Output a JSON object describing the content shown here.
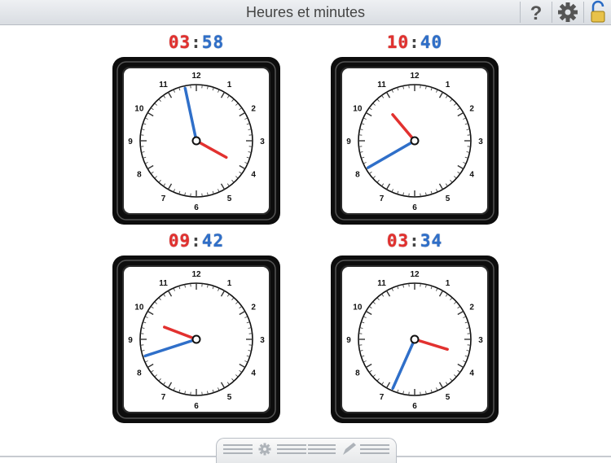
{
  "header": {
    "title": "Heures et minutes",
    "help_icon": "question-mark-icon",
    "settings_icon": "gear-icon",
    "lock_icon": "padlock-open-icon"
  },
  "colors": {
    "hour_hand": "#e2312f",
    "minute_hand": "#2f6fc9",
    "frame": "#111111",
    "toolbar": "#dfe3e8"
  },
  "dial_numbers": [
    "12",
    "1",
    "2",
    "3",
    "4",
    "5",
    "6",
    "7",
    "8",
    "9",
    "10",
    "11"
  ],
  "clocks": [
    {
      "hours": "03",
      "minutes": "58",
      "h": 3,
      "m": 58
    },
    {
      "hours": "10",
      "minutes": "40",
      "h": 10,
      "m": 40
    },
    {
      "hours": "09",
      "minutes": "42",
      "h": 9,
      "m": 42
    },
    {
      "hours": "03",
      "minutes": "34",
      "h": 3,
      "m": 34
    }
  ],
  "footer": {
    "gear_icon": "gear-icon",
    "pencil_icon": "pencil-icon"
  }
}
